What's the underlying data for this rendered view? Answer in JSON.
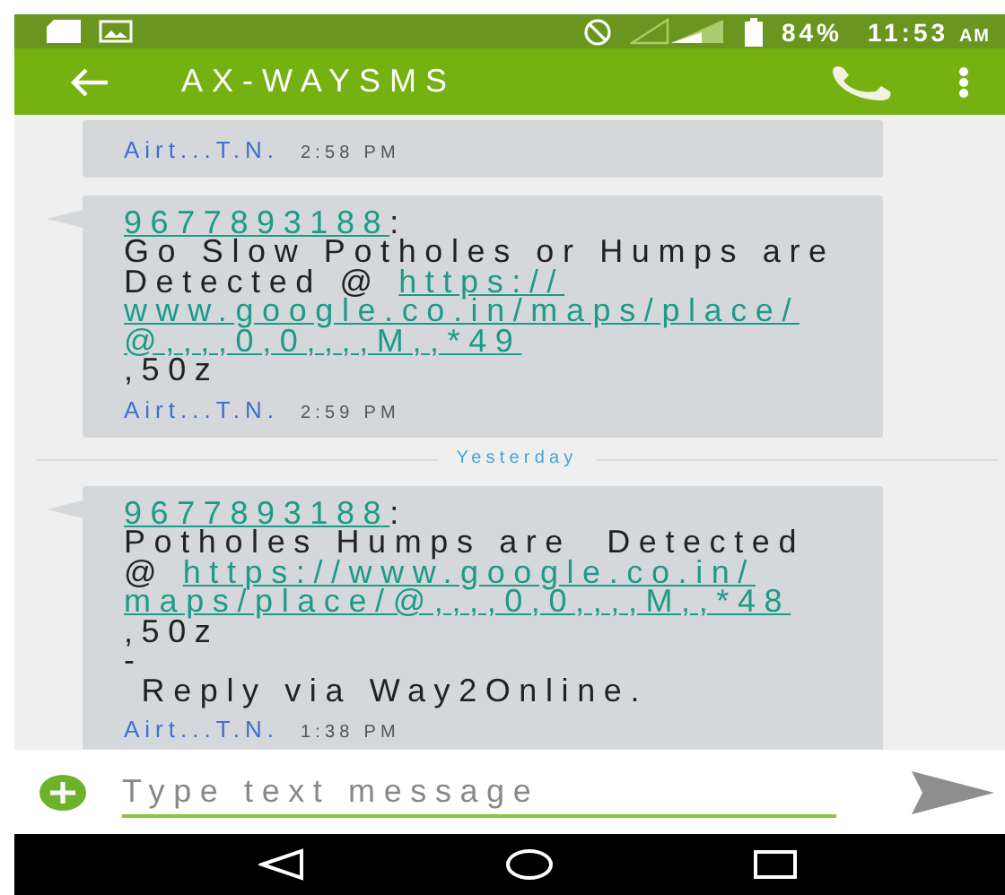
{
  "status_bar": {
    "battery": "84%",
    "time": "11:53",
    "meridiem": "AM"
  },
  "app_bar": {
    "title": "AX-WAYSMS"
  },
  "messages": [
    {
      "kind": "message",
      "sender": "Airt...T.N.",
      "time": "2:58 PM"
    },
    {
      "kind": "message",
      "lines": [
        [
          {
            "kind": "link",
            "text": "9677893188"
          },
          {
            "kind": "text",
            "text": ":"
          }
        ],
        [
          {
            "kind": "text",
            "text": "Go Slow Potholes or Humps are"
          }
        ],
        [
          {
            "kind": "text",
            "text": "Detected @ "
          },
          {
            "kind": "link",
            "text": "https://"
          }
        ],
        [
          {
            "kind": "link",
            "text": "www.google.co.in/maps/place/"
          }
        ],
        [
          {
            "kind": "link",
            "text": "@,,,,0,0,,,,M,,*49"
          }
        ],
        [
          {
            "kind": "text",
            "text": ",50z"
          }
        ]
      ],
      "sender": "Airt...T.N.",
      "time": "2:59 PM"
    },
    {
      "kind": "divider",
      "label": "Yesterday"
    },
    {
      "kind": "message",
      "lines": [
        [
          {
            "kind": "link",
            "text": "9677893188"
          },
          {
            "kind": "text",
            "text": ":"
          }
        ],
        [
          {
            "kind": "text",
            "text": "Potholes Humps are  Detected"
          }
        ],
        [
          {
            "kind": "text",
            "text": "@ "
          },
          {
            "kind": "link",
            "text": "https://www.google.co.in/"
          }
        ],
        [
          {
            "kind": "link",
            "text": "maps/place/@,,,,0,0,,,,M,,*48"
          }
        ],
        [
          {
            "kind": "text",
            "text": ",50z"
          }
        ],
        [
          {
            "kind": "text",
            "text": "-"
          }
        ],
        [
          {
            "kind": "text",
            "text": " Reply via Way2Online."
          }
        ]
      ],
      "sender": "Airt...T.N.",
      "time": "1:38 PM"
    }
  ],
  "composer": {
    "placeholder": "Type text message"
  }
}
